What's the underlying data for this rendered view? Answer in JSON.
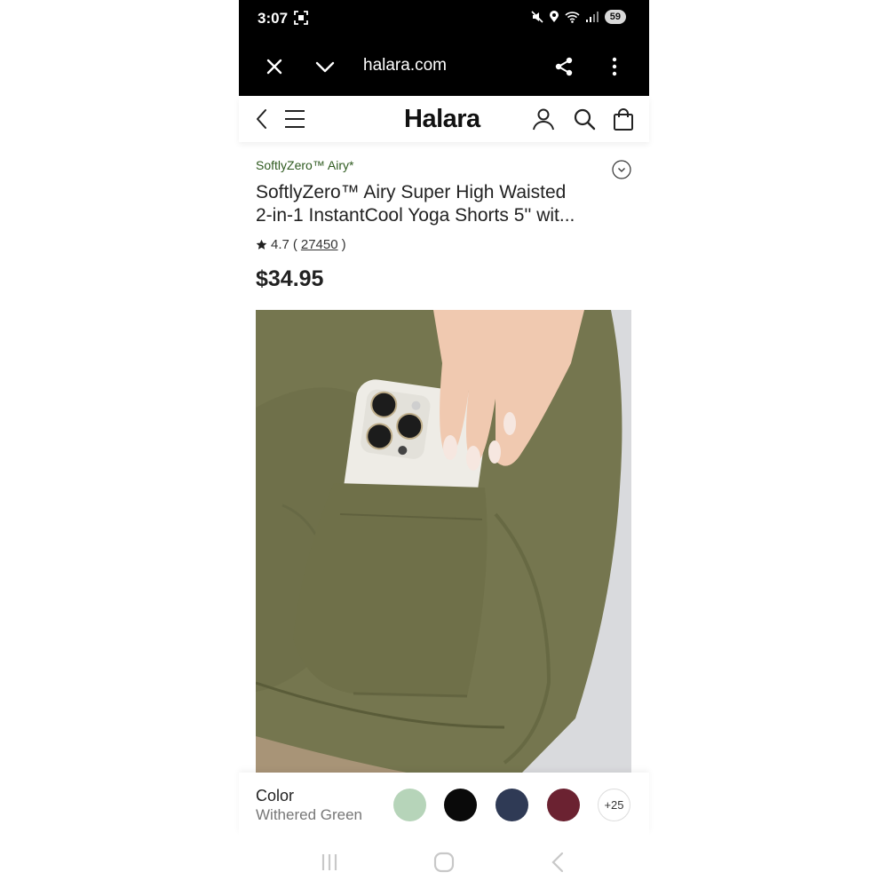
{
  "status": {
    "time": "3:07",
    "battery": "59"
  },
  "browser": {
    "url": "halara.com"
  },
  "site": {
    "logo": "Halara"
  },
  "product": {
    "collection": "SoftlyZero™ Airy*",
    "title_line1": "SoftlyZero™ Airy Super High Waisted",
    "title_line2": "2-in-1 InstantCool Yoga Shorts 5'' wit...",
    "rating": "4.7",
    "open_paren": "(",
    "review_count": "27450",
    "close_paren": ")",
    "price": "$34.95"
  },
  "color_picker": {
    "label": "Color",
    "selected": "Withered Green",
    "swatches": [
      "#b6d4b9",
      "#0a0a0a",
      "#2f3a55",
      "#6b2231"
    ],
    "more": "+25"
  },
  "icons": {
    "close": "close-icon",
    "chevron_down": "chevron-down-icon",
    "share": "share-icon",
    "more": "more-vert-icon",
    "back": "chevron-left-icon",
    "menu": "hamburger-icon",
    "account": "user-icon",
    "search": "search-icon",
    "bag": "shopping-bag-icon",
    "expand": "expand-circle-icon",
    "star": "star-icon"
  }
}
